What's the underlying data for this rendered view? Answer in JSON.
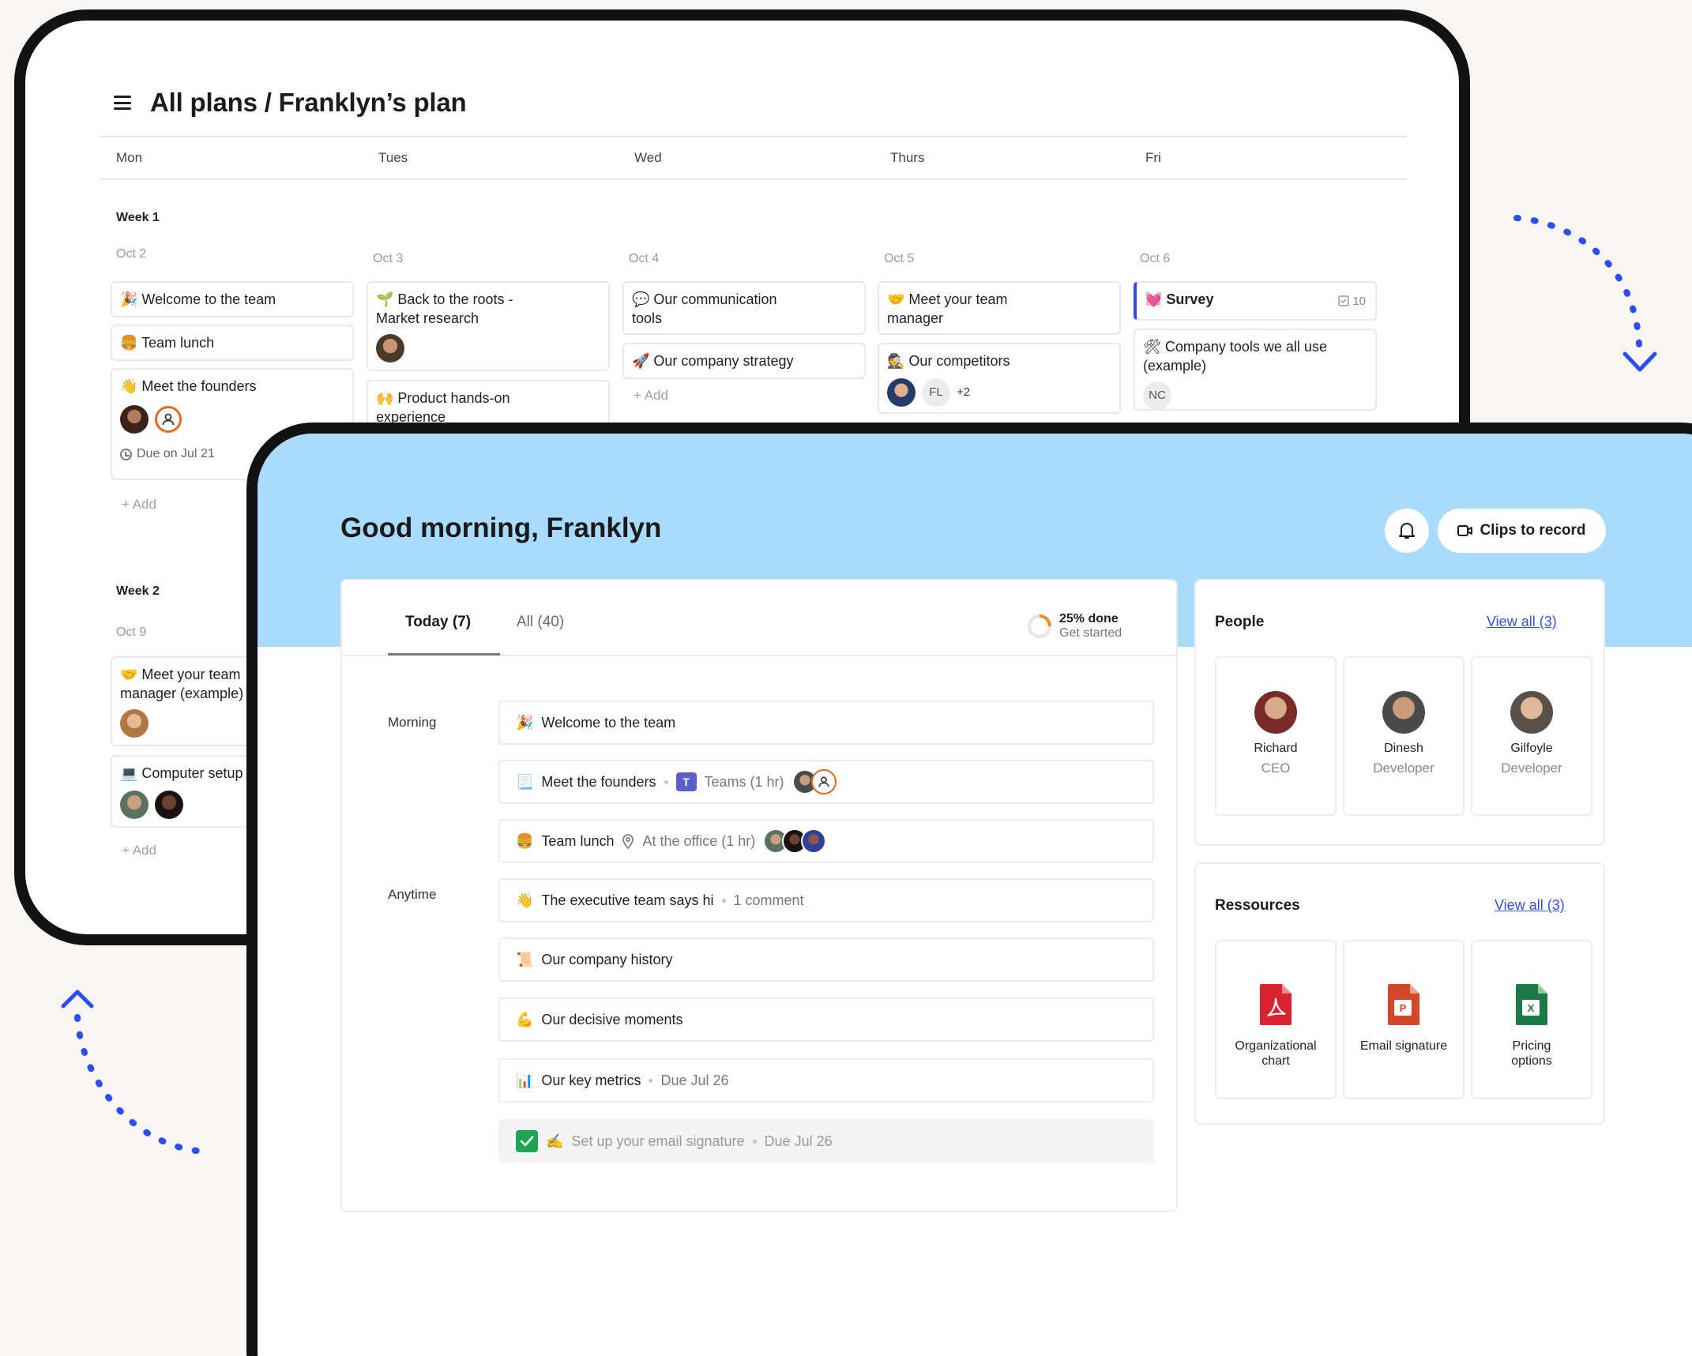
{
  "plan": {
    "title": "All plans / Franklyn’s plan",
    "days": [
      "Mon",
      "Tues",
      "Wed",
      "Thurs",
      "Fri"
    ],
    "week1_label": "Week 1",
    "week2_label": "Week 2",
    "week1_dates": [
      "Oct 2",
      "Oct 3",
      "Oct 4",
      "Oct 5",
      "Oct 6"
    ],
    "week2_dates": [
      "Oct 9"
    ],
    "cards": {
      "welcome": "🎉 Welcome to the team",
      "team_lunch": "🍔 Team lunch",
      "founders": "👋 Meet the founders",
      "founders_due": "Due on Jul 21",
      "roots_line1": "🌱 Back to the roots -",
      "roots_line2": "Market research",
      "product_line1": "🙌 Product hands-on",
      "product_line2": "experience",
      "comm_line1": "💬 Our communication",
      "comm_line2": "tools",
      "strategy": "🚀 Our company strategy",
      "manager_line1": "🤝 Meet your team",
      "manager_line2": "manager",
      "competitors": "🕵️ Our competitors",
      "competitors_initials": "FL",
      "competitors_more": "+2",
      "survey": "💓 Survey",
      "survey_count": "10",
      "tools_line1": "🛠 Company tools we all use",
      "tools_line2": "(example)",
      "tools_initials": "NC",
      "w2_manager_line1": "🤝 Meet your team",
      "w2_manager_line2": "manager (example)",
      "w2_setup": "💻 Computer setup"
    },
    "add_label": "+ Add"
  },
  "dashboard": {
    "greeting": "Good morning, Franklyn",
    "clips_button": "Clips to record",
    "tabs": {
      "today": "Today (7)",
      "all": "All (40)"
    },
    "progress": {
      "value": 0.25,
      "label": "25% done",
      "sub": "Get started"
    },
    "sections": {
      "morning": "Morning",
      "anytime": "Anytime"
    },
    "tasks": [
      {
        "emoji": "🎉",
        "title": "Welcome to the team"
      },
      {
        "emoji": "📃",
        "title": "Meet the founders",
        "meta": "Teams (1 hr)"
      },
      {
        "emoji": "🍔",
        "title": "Team lunch",
        "meta": "At the office (1 hr)"
      },
      {
        "emoji": "👋",
        "title": "The executive team says hi",
        "meta": "1 comment"
      },
      {
        "emoji": "📜",
        "title": "Our company history"
      },
      {
        "emoji": "💪",
        "title": "Our decisive moments"
      },
      {
        "emoji": "📊",
        "title": "Our key metrics",
        "meta": "Due Jul 26"
      },
      {
        "emoji": "✍️",
        "title": "Set up your email signature",
        "meta": "Due Jul 26",
        "done": true
      }
    ],
    "people": {
      "title": "People",
      "view_all": "View all (3)",
      "items": [
        {
          "name": "Richard",
          "role": "CEO"
        },
        {
          "name": "Dinesh",
          "role": "Developer"
        },
        {
          "name": "Gilfoyle",
          "role": "Developer"
        }
      ]
    },
    "resources": {
      "title": "Ressources",
      "view_all": "View all (3)",
      "items": [
        {
          "line1": "Organizational",
          "line2": "chart",
          "type": "pdf",
          "color": "#d9232e"
        },
        {
          "line1": "Email signature",
          "line2": "",
          "type": "ppt",
          "color": "#d2472a"
        },
        {
          "line1": "Pricing",
          "line2": "options",
          "type": "xls",
          "color": "#1d7a44"
        }
      ]
    }
  },
  "colors": {
    "accent_blue": "#2f4ff0",
    "header_band": "#a9dbfd",
    "progress_orange": "#f08a24",
    "check_green": "#1ea453"
  }
}
